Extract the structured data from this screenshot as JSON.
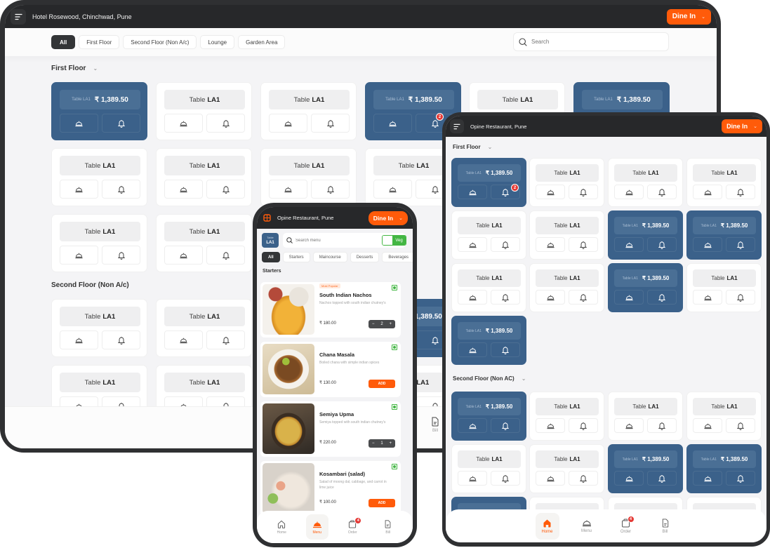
{
  "large_tablet": {
    "venue": "Hotel Rosewood, Chinchwad, Pune",
    "dine_in_label": "Dine In",
    "filters": [
      "All",
      "First Floor",
      "Second Floor (Non A/c)",
      "Lounge",
      "Garden Area"
    ],
    "active_filter": "All",
    "search_placeholder": "Search",
    "sections": [
      {
        "title": "First Floor"
      },
      {
        "title": "Second Floor (Non A/c)"
      }
    ],
    "bottom_nav_partial": {
      "label": "Bill",
      "icon": "bill-icon"
    }
  },
  "small_tablet": {
    "venue": "Opine Restaurant, Pune",
    "dine_in_label": "Dine In",
    "sections": [
      {
        "title": "First Floor"
      },
      {
        "title": "Second Floor (Non AC)"
      }
    ],
    "bottom_nav": [
      {
        "label": "Home",
        "icon": "home-icon",
        "active": true
      },
      {
        "label": "Menu",
        "icon": "cloche-icon",
        "active": false
      },
      {
        "label": "Order",
        "icon": "order-bag-icon",
        "active": false,
        "badge": "4"
      },
      {
        "label": "Bill",
        "icon": "bill-icon",
        "active": false
      }
    ]
  },
  "table": {
    "word": "Table",
    "code": "LA1",
    "amount": "₹ 1,389.50",
    "occupied_label": "Table LA1",
    "notification_count": "2"
  },
  "phone": {
    "venue": "Opine Restaurant, Pune",
    "dine_in_label": "Dine In",
    "table_chip": {
      "small": "Table",
      "big": "LA1"
    },
    "search_placeholder": "Search menu",
    "veg_label": "Veg",
    "categories": [
      "All",
      "Starters",
      "Maincourse",
      "Desserts",
      "Beverages"
    ],
    "section": "Starters",
    "dishes": [
      {
        "tag": "Most Popular",
        "name": "South Indian Nachos",
        "desc": "Nachos topped with south indian chutney's",
        "price": "₹ 180.00",
        "qty": "2"
      },
      {
        "tag": "",
        "name": "Chana Masala",
        "desc": "Boiled chana with simple indian spices",
        "price": "₹ 130.00",
        "action": "ADD"
      },
      {
        "tag": "",
        "name": "Semiya Upma",
        "desc": "Semiya topped with south indian chutney's",
        "price": "₹ 220.00",
        "qty": "1"
      },
      {
        "tag": "",
        "name": "Kosambari  (salad)",
        "desc": "Salad of moong dal, cabbage, and carrot in lime juice",
        "price": "₹ 100.00",
        "action": "ADD"
      }
    ],
    "bottom_nav": [
      {
        "label": "Home",
        "icon": "home-icon",
        "active": false
      },
      {
        "label": "Menu",
        "icon": "cloche-icon",
        "active": true
      },
      {
        "label": "Order",
        "icon": "order-bag-icon",
        "active": false,
        "badge": "4"
      },
      {
        "label": "Bill",
        "icon": "bill-icon",
        "active": false
      }
    ]
  },
  "colors": {
    "accent": "#ff5b0a",
    "occupied": "#3b618a",
    "topbar": "#27282a",
    "badge": "#e53935",
    "veg": "#43b643"
  },
  "icons": {
    "menu": "hamburger-menu-icon",
    "search": "search-icon",
    "serve": "cloche-icon",
    "call": "bell-icon",
    "chevron": "chevron-down-icon"
  }
}
